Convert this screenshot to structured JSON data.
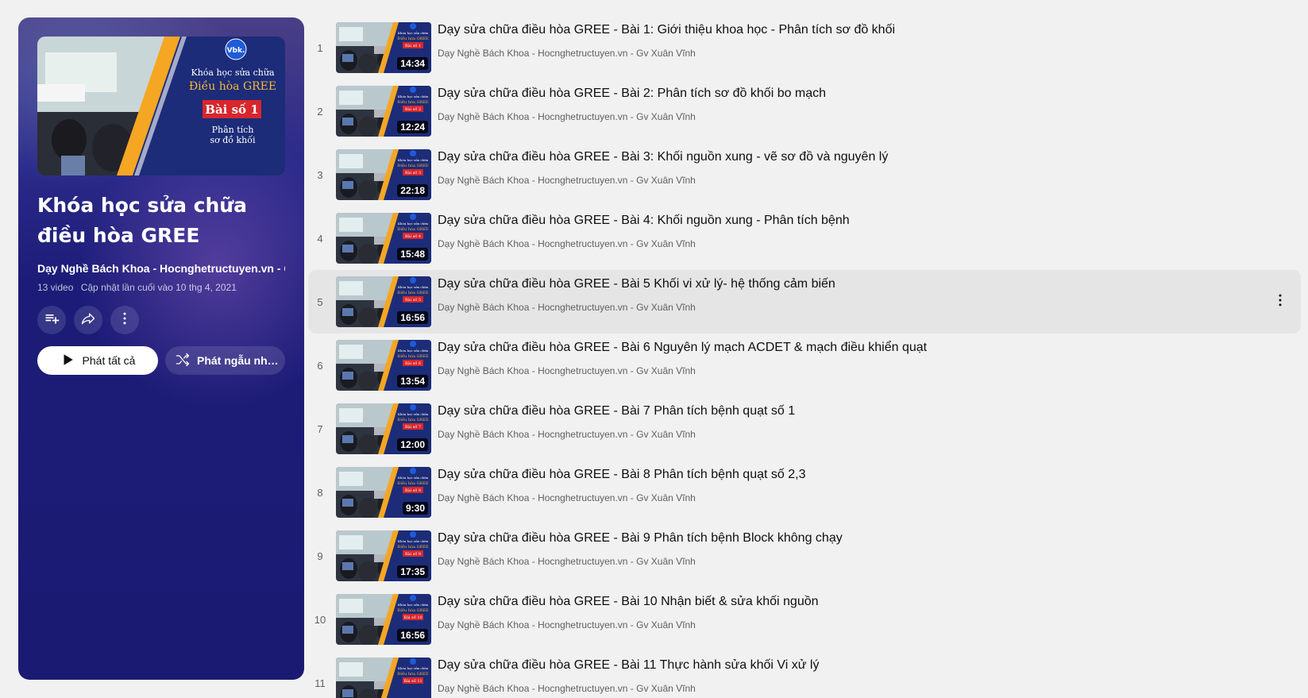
{
  "playlist": {
    "title": "Khóa học sửa chữa điều hòa GREE",
    "channel": "Dạy Nghề Bách Khoa - Hocnghetructuyen.vn - Gv Xuân Vĩnh",
    "video_count": "13 video",
    "updated": "Cập nhật lần cuối vào 10 thg 4, 2021",
    "play_all_label": "Phát tất cả",
    "shuffle_label": "Phát ngẫu nhiên",
    "hero": {
      "logo": "Vbk.",
      "line1": "Khóa học sửa chữa",
      "line2": "Điều hòa GREE",
      "badge": "Bài số 1",
      "line3": "Phân tích",
      "line4": "sơ đồ khối"
    }
  },
  "icons": {
    "save": "add-to-queue-icon",
    "share": "share-icon",
    "more": "more-vert-icon",
    "play": "play-icon",
    "shuffle": "shuffle-icon"
  },
  "colors": {
    "panel_bg": "#1b1a72",
    "page_bg": "#f1f1f1",
    "active_row": "#e5e5e5"
  },
  "thumb_text": {
    "top": "Khóa học sửa chữa",
    "mid": "Điều hòa GREE"
  },
  "videos": [
    {
      "index": "1",
      "title": "Dạy sửa chữa điều hòa GREE - Bài 1: Giới thiệu khoa học - Phân tích sơ đồ khối",
      "channel": "Dạy Nghề Bách Khoa - Hocnghetructuyen.vn - Gv Xuân Vĩnh",
      "duration": "14:34",
      "badge": "Bài số 1"
    },
    {
      "index": "2",
      "title": "Dạy sửa chữa điều hòa GREE - Bài 2: Phân tích sơ đồ khối bo mạch",
      "channel": "Dạy Nghề Bách Khoa - Hocnghetructuyen.vn - Gv Xuân Vĩnh",
      "duration": "12:24",
      "badge": "Bài số 2"
    },
    {
      "index": "3",
      "title": "Dạy sửa chữa điều hòa GREE - Bài 3: Khối nguồn xung - vẽ sơ đồ và nguyên lý",
      "channel": "Dạy Nghề Bách Khoa - Hocnghetructuyen.vn - Gv Xuân Vĩnh",
      "duration": "22:18",
      "badge": "Bài số 3"
    },
    {
      "index": "4",
      "title": "Dạy sửa chữa điều hòa GREE - Bài 4: Khối nguồn xung - Phân tích bệnh",
      "channel": "Dạy Nghề Bách Khoa - Hocnghetructuyen.vn - Gv Xuân Vĩnh",
      "duration": "15:48",
      "badge": "Bài số 4"
    },
    {
      "index": "5",
      "title": "Dạy sửa chữa điều hòa GREE - Bài 5 Khối vi xử lý- hệ thống cảm biến",
      "channel": "Dạy Nghề Bách Khoa - Hocnghetructuyen.vn - Gv Xuân Vĩnh",
      "duration": "16:56",
      "badge": "Bài số 5"
    },
    {
      "index": "6",
      "title": "Dạy sửa chữa điều hòa GREE - Bài 6 Nguyên lý mạch ACDET & mạch điều khiển quạt",
      "channel": "Dạy Nghề Bách Khoa - Hocnghetructuyen.vn - Gv Xuân Vĩnh",
      "duration": "13:54",
      "badge": "Bài số 6"
    },
    {
      "index": "7",
      "title": "Dạy sửa chữa điều hòa GREE - Bài 7 Phân tích bệnh quạt số 1",
      "channel": "Dạy Nghề Bách Khoa - Hocnghetructuyen.vn - Gv Xuân Vĩnh",
      "duration": "12:00",
      "badge": "Bài số 7"
    },
    {
      "index": "8",
      "title": "Dạy sửa chữa điều hòa GREE - Bài 8 Phân tích bệnh quạt số 2,3",
      "channel": "Dạy Nghề Bách Khoa - Hocnghetructuyen.vn - Gv Xuân Vĩnh",
      "duration": "9:30",
      "badge": "Bài số 8"
    },
    {
      "index": "9",
      "title": "Dạy sửa chữa điều hòa GREE - Bài 9 Phân tích bệnh Block không chạy",
      "channel": "Dạy Nghề Bách Khoa - Hocnghetructuyen.vn - Gv Xuân Vĩnh",
      "duration": "17:35",
      "badge": "Bài số 9"
    },
    {
      "index": "10",
      "title": "Dạy sửa chữa điều hòa GREE - Bài 10 Nhận biết & sửa khối nguồn",
      "channel": "Dạy Nghề Bách Khoa - Hocnghetructuyen.vn - Gv Xuân Vĩnh",
      "duration": "16:56",
      "badge": "Bài số 10"
    },
    {
      "index": "11",
      "title": "Dạy sửa chữa điều hòa GREE - Bài 11 Thực hành sửa khối Vi xử lý",
      "channel": "Dạy Nghề Bách Khoa - Hocnghetructuyen.vn - Gv Xuân Vĩnh",
      "duration": "",
      "badge": "Bài số 11"
    }
  ],
  "active_index": 4
}
